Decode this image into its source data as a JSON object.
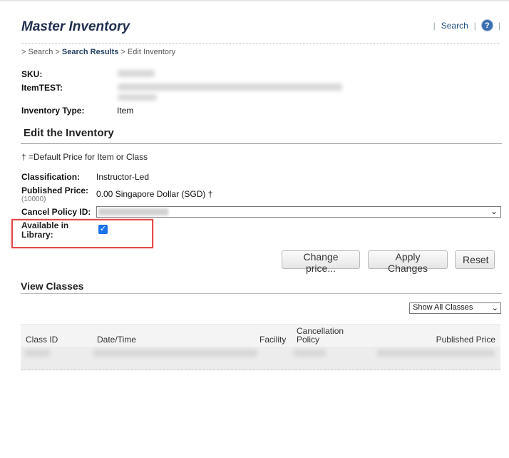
{
  "header": {
    "title": "Master Inventory",
    "search_link": "Search",
    "help_icon": "help-icon"
  },
  "breadcrumb": {
    "root": "> Search >",
    "current": "Search Results",
    "tail": "> Edit Inventory"
  },
  "details": {
    "sku_label": "SKU:",
    "item_label": "ItemTEST:",
    "type_label": "Inventory Type:",
    "type_value": "Item"
  },
  "edit": {
    "title": "Edit the Inventory",
    "dagger_note": "†   =Default Price for Item or Class",
    "classification_label": "Classification:",
    "classification_value": "Instructor-Led",
    "price_label": "Published Price:",
    "price_code": "(10000)",
    "price_value": "0.00 Singapore Dollar (SGD) †",
    "cancel_label": "Cancel Policy ID:",
    "available_label": "Available in Library:",
    "available_checked": true,
    "buttons": {
      "change_price": "Change price...",
      "apply": "Apply Changes",
      "reset": "Reset"
    }
  },
  "classes": {
    "title": "View Classes",
    "filter_value": "Show All Classes",
    "columns": {
      "class_id": "Class ID",
      "date_time": "Date/Time",
      "facility": "Facility",
      "cancellation_1": "Cancellation",
      "cancellation_2": "Policy",
      "published_price": "Published Price"
    }
  },
  "colors": {
    "title": "#1f2f4f",
    "highlight": "#e34a4a",
    "checkbox": "#1a73e8"
  }
}
